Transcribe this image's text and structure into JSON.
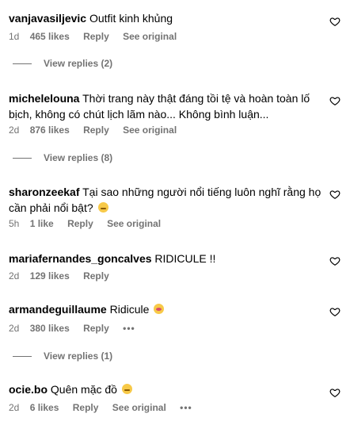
{
  "comments": [
    {
      "username": "vanjavasiljevic",
      "text": "Outfit kinh khủng",
      "time": "1d",
      "likes": "465 likes",
      "reply": "Reply",
      "see_original": "See original",
      "view_replies": "View replies (2)"
    },
    {
      "username": "michelelouna",
      "text": "Thời trang này thật đáng tồi tệ và hoàn toàn lố",
      "text2": "bịch, không có chút lịch lãm nào... Không bình luận...",
      "time": "2d",
      "likes": "876 likes",
      "reply": "Reply",
      "see_original": "See original",
      "view_replies": "View replies (8)"
    },
    {
      "username": "sharonzeekaf",
      "text": "Tại sao những người nổi tiếng luôn nghĩ rằng họ",
      "text2": "cần phải nổi bật?",
      "emoji": "thinking-face-emoji",
      "time": "5h",
      "likes": "1 like",
      "reply": "Reply",
      "see_original": "See original"
    },
    {
      "username": "mariafernandes_goncalves",
      "text": "RIDICULE !!",
      "time": "2d",
      "likes": "129 likes",
      "reply": "Reply"
    },
    {
      "username": "armandeguillaume",
      "text": "Ridicule",
      "emoji": "flushed-face-emoji",
      "time": "2d",
      "likes": "380 likes",
      "reply": "Reply",
      "more": "•••",
      "view_replies": "View replies (1)"
    },
    {
      "username": "ocie.bo",
      "text": "Quên mặc đồ",
      "emoji": "rolling-eyes-emoji",
      "time": "2d",
      "likes": "6 likes",
      "reply": "Reply",
      "see_original": "See original",
      "more": "•••"
    }
  ],
  "icons": {
    "like": "heart-outline-icon"
  },
  "colors": {
    "text": "#000000",
    "muted": "#737373",
    "background": "#ffffff"
  }
}
